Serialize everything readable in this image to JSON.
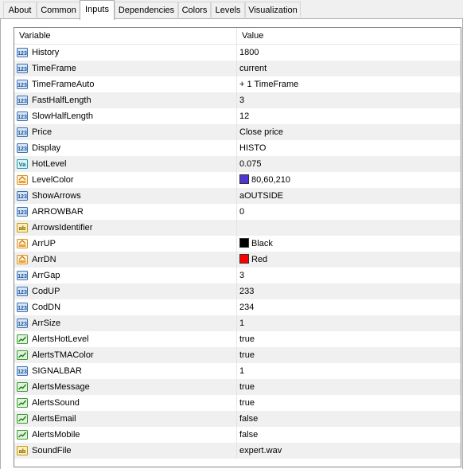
{
  "tabs": [
    {
      "label": "About",
      "active": false
    },
    {
      "label": "Common",
      "active": false
    },
    {
      "label": "Inputs",
      "active": true
    },
    {
      "label": "Dependencies",
      "active": false
    },
    {
      "label": "Colors",
      "active": false
    },
    {
      "label": "Levels",
      "active": false
    },
    {
      "label": "Visualization",
      "active": false
    }
  ],
  "table": {
    "col_variable": "Variable",
    "col_value": "Value",
    "rows": [
      {
        "name": "History",
        "value": "1800",
        "icon": "int-icon"
      },
      {
        "name": "TimeFrame",
        "value": "current",
        "icon": "int-icon"
      },
      {
        "name": "TimeFrameAuto",
        "value": "+ 1 TimeFrame",
        "icon": "int-icon"
      },
      {
        "name": "FastHalfLength",
        "value": "3",
        "icon": "int-icon"
      },
      {
        "name": "SlowHalfLength",
        "value": "12",
        "icon": "int-icon"
      },
      {
        "name": "Price",
        "value": "Close price",
        "icon": "int-icon"
      },
      {
        "name": "Display",
        "value": "HISTO",
        "icon": "int-icon"
      },
      {
        "name": "HotLevel",
        "value": "0.075",
        "icon": "double-icon"
      },
      {
        "name": "LevelColor",
        "value": "80,60,210",
        "icon": "color-icon",
        "swatch": "#5036d2"
      },
      {
        "name": "ShowArrows",
        "value": "aOUTSIDE",
        "icon": "int-icon"
      },
      {
        "name": "ARROWBAR",
        "value": "0",
        "icon": "int-icon"
      },
      {
        "name": "ArrowsIdentifier",
        "value": "",
        "icon": "string-icon"
      },
      {
        "name": "ArrUP",
        "value": "Black",
        "icon": "color-icon",
        "swatch": "#000000"
      },
      {
        "name": "ArrDN",
        "value": "Red",
        "icon": "color-icon",
        "swatch": "#ff0000"
      },
      {
        "name": "ArrGap",
        "value": "3",
        "icon": "int-icon"
      },
      {
        "name": "CodUP",
        "value": "233",
        "icon": "int-icon"
      },
      {
        "name": "CodDN",
        "value": "234",
        "icon": "int-icon"
      },
      {
        "name": "ArrSize",
        "value": "1",
        "icon": "int-icon"
      },
      {
        "name": "AlertsHotLevel",
        "value": "true",
        "icon": "bool-icon"
      },
      {
        "name": "AlertsTMAColor",
        "value": "true",
        "icon": "bool-icon"
      },
      {
        "name": "SIGNALBAR",
        "value": "1",
        "icon": "int-icon"
      },
      {
        "name": "AlertsMessage",
        "value": "true",
        "icon": "bool-icon"
      },
      {
        "name": "AlertsSound",
        "value": "true",
        "icon": "bool-icon"
      },
      {
        "name": "AlertsEmail",
        "value": "false",
        "icon": "bool-icon"
      },
      {
        "name": "AlertsMobile",
        "value": "false",
        "icon": "bool-icon"
      },
      {
        "name": "SoundFile",
        "value": "expert.wav",
        "icon": "string-icon"
      }
    ]
  },
  "icon_text": {
    "int": "123",
    "double": "Va",
    "string": "ab"
  },
  "colors": {
    "tab_border": "#adadad",
    "grid_border": "#828790",
    "alt_row": "#f0f0f0"
  }
}
